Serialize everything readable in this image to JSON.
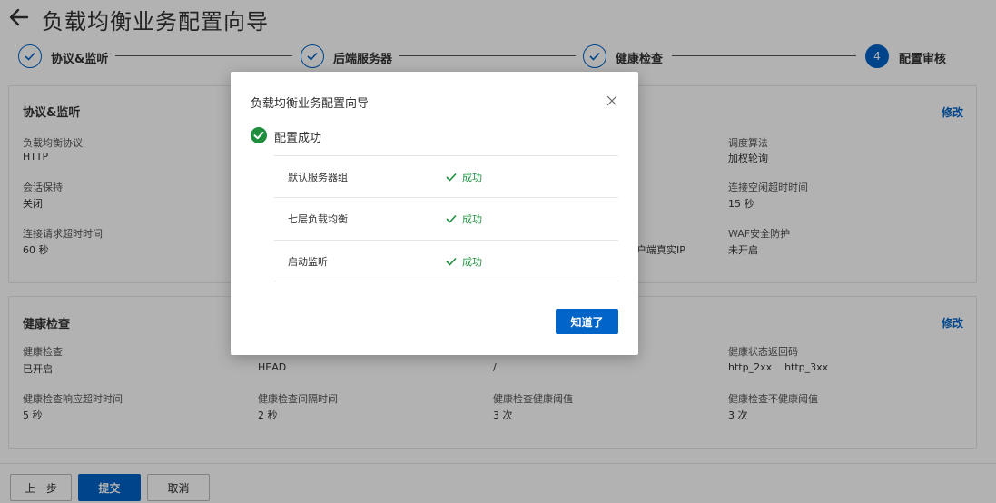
{
  "header": {
    "title": "负载均衡业务配置向导"
  },
  "steps": [
    {
      "label": "协议&监听",
      "number": "1",
      "status": "done"
    },
    {
      "label": "后端服务器",
      "number": "2",
      "status": "done"
    },
    {
      "label": "健康检查",
      "number": "3",
      "status": "done"
    },
    {
      "label": "配置审核",
      "number": "4",
      "status": "active"
    }
  ],
  "protocol_panel": {
    "title": "协议&监听",
    "edit": "修改",
    "fields": [
      {
        "label": "负载均衡协议",
        "value": "HTTP"
      },
      {
        "label": "会话保持",
        "value": "关闭"
      },
      {
        "label": "连接请求超时时间",
        "value": "60 秒"
      },
      {
        "label": "客户端真实IP",
        "value": ""
      },
      {
        "label": "调度算法",
        "value": "加权轮询"
      },
      {
        "label": "连接空闲超时时间",
        "value": "15 秒"
      },
      {
        "label": "WAF安全防护",
        "value": "未开启"
      }
    ],
    "partial_text": "客户端真实IP"
  },
  "health_panel": {
    "title": "健康检查",
    "edit": "修改",
    "fields": [
      {
        "label": "健康检查",
        "value": "已开启"
      },
      {
        "label": "",
        "value": "HEAD"
      },
      {
        "label": "",
        "value": "/"
      },
      {
        "label": "健康状态返回码",
        "value": "http_2xx    http_3xx"
      },
      {
        "label": "健康检查响应超时时间",
        "value": "5 秒"
      },
      {
        "label": "健康检查间隔时间",
        "value": "2 秒"
      },
      {
        "label": "健康检查健康阈值",
        "value": "3 次"
      },
      {
        "label": "健康检查不健康阈值",
        "value": "3 次"
      }
    ]
  },
  "footer": {
    "prev": "上一步",
    "submit": "提交",
    "cancel": "取消"
  },
  "modal": {
    "title": "负载均衡业务配置向导",
    "success": "配置成功",
    "rows": [
      {
        "name": "默认服务器组",
        "status": "成功"
      },
      {
        "name": "七层负载均衡",
        "status": "成功"
      },
      {
        "name": "启动监听",
        "status": "成功"
      }
    ],
    "ok": "知道了"
  },
  "colors": {
    "primary": "#0064c8",
    "success": "#1e8e3e"
  }
}
